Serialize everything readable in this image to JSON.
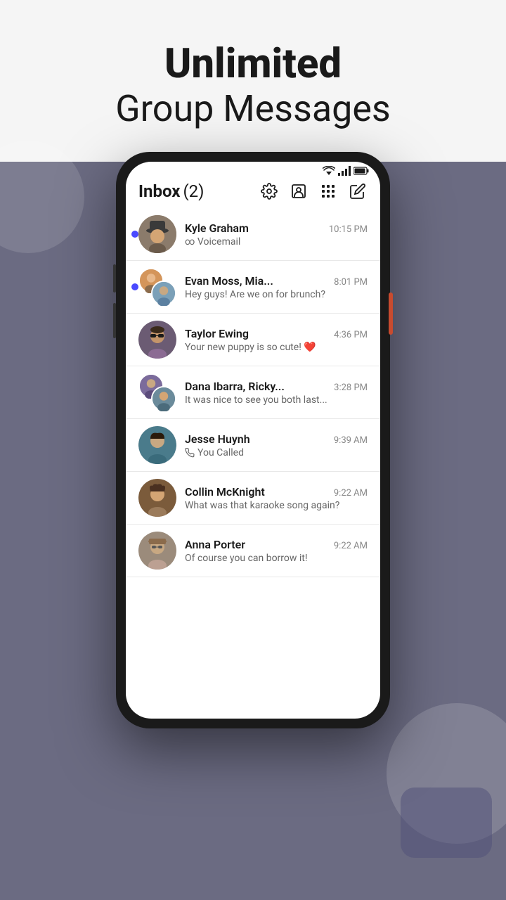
{
  "hero": {
    "title_bold": "Unlimited",
    "title_light": "Group Messages"
  },
  "phone": {
    "status_bar": {
      "wifi_icon": "wifi",
      "signal_icon": "signal",
      "battery_icon": "battery"
    },
    "inbox": {
      "title": "Inbox",
      "count": "(2)",
      "icons": [
        "settings",
        "contacts",
        "apps",
        "compose"
      ]
    },
    "messages": [
      {
        "id": "kyle",
        "name": "Kyle Graham",
        "time": "10:15 PM",
        "preview": "∞ Voicemail",
        "type": "voicemail",
        "unread": true
      },
      {
        "id": "evan",
        "name": "Evan Moss, Mia...",
        "time": "8:01 PM",
        "preview": "Hey guys! Are we on for brunch?",
        "type": "group",
        "unread": true
      },
      {
        "id": "taylor",
        "name": "Taylor Ewing",
        "time": "4:36 PM",
        "preview": "Your new puppy is so cute! ❤️",
        "type": "normal",
        "unread": false
      },
      {
        "id": "dana",
        "name": "Dana Ibarra, Ricky...",
        "time": "3:28 PM",
        "preview": "It was nice to see you both last...",
        "type": "group",
        "unread": false
      },
      {
        "id": "jesse",
        "name": "Jesse Huynh",
        "time": "9:39 AM",
        "preview": "You Called",
        "type": "called",
        "unread": false
      },
      {
        "id": "collin",
        "name": "Collin McKnight",
        "time": "9:22 AM",
        "preview": "What was that karaoke song again?",
        "type": "normal",
        "unread": false
      },
      {
        "id": "anna",
        "name": "Anna Porter",
        "time": "9:22 AM",
        "preview": "Of course you can borrow it!",
        "type": "normal",
        "unread": false
      }
    ]
  }
}
